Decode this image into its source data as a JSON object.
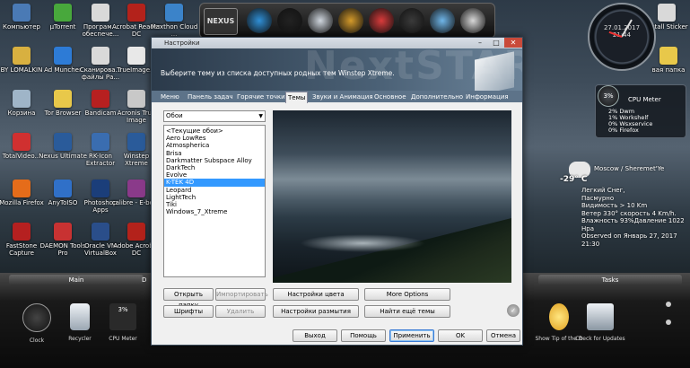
{
  "desktop_icons": [
    {
      "label": "Компьютер",
      "color": "#4a7ab5"
    },
    {
      "label": "µTorrent",
      "color": "#48a83c"
    },
    {
      "label": "Програм... обеспече...",
      "color": "#d9d9d9"
    },
    {
      "label": "Acrobat Reader DC",
      "color": "#b3221b"
    },
    {
      "label": "Maxthon Cloud ...",
      "color": "#3b83c9"
    },
    {
      "label": "BY LOMALKIN",
      "color": "#d8b040"
    },
    {
      "label": "Ad Muncher",
      "color": "#2d7bd6"
    },
    {
      "label": "Сканирова... файлы Ра...",
      "color": "#d9d9d9"
    },
    {
      "label": "TrueImage...",
      "color": "#e8e8e8"
    },
    {
      "label": "Корзина",
      "color": "#9fb5c8"
    },
    {
      "label": "Tor Browser",
      "color": "#e8c84a"
    },
    {
      "label": "Bandicam",
      "color": "#b72020"
    },
    {
      "label": "Acronis True Image",
      "color": "#c8c8c8"
    },
    {
      "label": "TotalVideo...",
      "color": "#d03030"
    },
    {
      "label": "Nexus Ultimate",
      "color": "#2a5b9a"
    },
    {
      "label": "RK-Icon Extractor",
      "color": "#3a6db0"
    },
    {
      "label": "Winstep Xtreme",
      "color": "#2a5b9a"
    },
    {
      "label": "Mozilla Firefox",
      "color": "#e56c1a"
    },
    {
      "label": "AnyToISO",
      "color": "#3070c8"
    },
    {
      "label": "Photoshop Apps",
      "color": "#1b3e7a"
    },
    {
      "label": "calibre - E-book",
      "color": "#8a3a8a"
    },
    {
      "label": "FastStone Capture",
      "color": "#b52020"
    },
    {
      "label": "DAEMON Tools Pro",
      "color": "#c83232"
    },
    {
      "label": "Oracle VM VirtualBox",
      "color": "#2a4e8a"
    },
    {
      "label": "Adobe Acrobat DC",
      "color": "#b3221b"
    }
  ],
  "right_icons": [
    {
      "label": "Install Sticker",
      "color": "#d9d9d9"
    },
    {
      "label": "вая папка",
      "color": "#e8c84a"
    }
  ],
  "top_dock": {
    "items": [
      {
        "name": "nexus-logo-icon",
        "color": "#444"
      },
      {
        "name": "windows-logo-icon",
        "color": "#2f8fd6"
      },
      {
        "name": "clock-dock-icon",
        "color": "#222"
      },
      {
        "name": "recycle-bin-icon",
        "color": "#cfd6de"
      },
      {
        "name": "gear-dock-icon",
        "color": "#d49a2a"
      },
      {
        "name": "mail-dock-icon",
        "color": "#d93b3b"
      },
      {
        "name": "camera-dock-icon",
        "color": "#3a3a3a"
      },
      {
        "name": "vista-orb-icon",
        "color": "#6fb5e8"
      },
      {
        "name": "shutdown-icon",
        "color": "#d8d8d8"
      }
    ],
    "label": "NEXUS"
  },
  "clock": {
    "date": "27.01.2017",
    "time": "21:44"
  },
  "cpu_meter": {
    "badge": "3%",
    "title": "CPU Meter",
    "lines": [
      "2% Dwm",
      "1% Workshelf",
      "0% Wsxservice",
      "0% Firefox"
    ]
  },
  "weather": {
    "location": "Moscow / Sheremet'Ye",
    "temp": "-29° C",
    "lines": [
      "Легкий Снег,",
      "Пасмурно",
      "Видимость > 10 Km",
      "Ветер 330° скорость 4 Km/h.",
      "Влажность 93%Давление 1022 Hpa",
      "Observed on Январь 27, 2017 21:30"
    ]
  },
  "taskbar": {
    "left_tab": "Main",
    "left_tab2": "D",
    "right_tab": "Tasks",
    "items": [
      {
        "label": "Clock",
        "color": "#333"
      },
      {
        "label": "Recycler",
        "color": "#cfd6de"
      },
      {
        "label": "CPU Meter",
        "color": "#555",
        "badge": "3%"
      }
    ],
    "right_items": [
      {
        "label": "Show Tip of the D",
        "color": "#f0b530"
      },
      {
        "label": "Check for Updates",
        "color": "#cfd6de"
      }
    ]
  },
  "dialog": {
    "title": "Настройки",
    "banner_text": "Выберите тему из списка доступных родных тем Winstep Xtreme.",
    "banner_brand": "NextSTART",
    "tabs": [
      "Меню",
      "Панель задач",
      "Горячие точки",
      "Темы",
      "Звуки и Анимация",
      "Основное",
      "Дополнительно",
      "Информация"
    ],
    "active_tab": "Темы",
    "dropdown": {
      "value": "Обои"
    },
    "themes": [
      "<Текущие обои>",
      "Aero LowRes",
      "Atmospherica",
      "Brisa",
      "Darkmatter Subspace Alloy",
      "DarkTech",
      "Evolve",
      "K-TEK 4D",
      "Leopard",
      "LightTech",
      "Tiki",
      "Windows_7_Xtreme"
    ],
    "selected_theme": "K-TEK 4D",
    "buttons": {
      "open_folder": "Открыть папку",
      "import": "Импортировать",
      "fonts": "Шрифты",
      "delete": "Удалить",
      "color_settings": "Настройки цвета",
      "blur_settings": "Настройки размытия",
      "more_options": "More Options",
      "find_more": "Найти ещё темы",
      "exit": "Выход",
      "help": "Помощь",
      "apply": "Применить",
      "ok": "OK",
      "cancel": "Отмена"
    }
  }
}
